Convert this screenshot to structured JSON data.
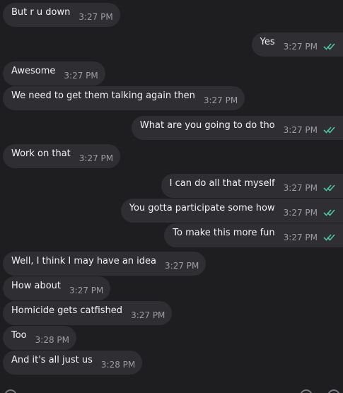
{
  "messages": [
    {
      "dir": "in",
      "text": "But r u down",
      "time": "3:27 PM"
    },
    {
      "dir": "out",
      "text": "Yes",
      "time": "3:27 PM"
    },
    {
      "dir": "in",
      "text": "Awesome",
      "time": "3:27 PM"
    },
    {
      "dir": "in",
      "text": "We need to get them talking again then",
      "time": "3:27 PM"
    },
    {
      "dir": "out",
      "text": "What are you going to do tho",
      "time": "3:27 PM"
    },
    {
      "dir": "in",
      "text": "Work on that",
      "time": "3:27 PM"
    },
    {
      "dir": "out",
      "text": "I can do all that myself",
      "time": "3:27 PM"
    },
    {
      "dir": "out",
      "text": "You gotta participate some how",
      "time": "3:27 PM"
    },
    {
      "dir": "out",
      "text": "To make this more fun",
      "time": "3:27 PM"
    },
    {
      "dir": "in",
      "text": "Well, I think I may have an idea",
      "time": "3:27 PM"
    },
    {
      "dir": "in",
      "text": "How about",
      "time": "3:27 PM"
    },
    {
      "dir": "in",
      "text": "Homicide gets catfished",
      "time": "3:27 PM"
    },
    {
      "dir": "in",
      "text": "Too",
      "time": "3:28 PM"
    },
    {
      "dir": "in",
      "text": "And it's all just us",
      "time": "3:28 PM"
    }
  ],
  "colors": {
    "background": "#1e1e21",
    "bubble": "#2f2f33",
    "text": "#f2f2f4",
    "time": "#9c9ca3",
    "read_ticks": "#4fc3a1"
  },
  "icons": {
    "read_receipt": "double-check-icon"
  }
}
